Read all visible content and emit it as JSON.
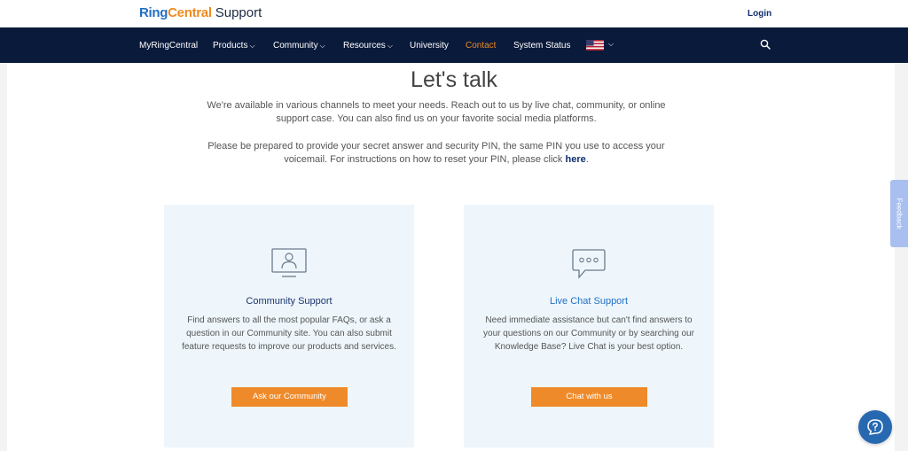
{
  "header": {
    "logo_ring": "Ring",
    "logo_central": "Central",
    "logo_support": "Support",
    "login_label": "Login"
  },
  "nav": {
    "items": [
      {
        "label": "MyRingCentral",
        "dropdown": false
      },
      {
        "label": "Products",
        "dropdown": true
      },
      {
        "label": "Community",
        "dropdown": true
      },
      {
        "label": "Resources",
        "dropdown": true
      },
      {
        "label": "University",
        "dropdown": false
      },
      {
        "label": "Contact",
        "dropdown": false,
        "active": true
      },
      {
        "label": "System Status",
        "dropdown": false
      }
    ],
    "flag_icon": "us-flag-icon",
    "search_icon": "search-icon"
  },
  "main": {
    "title": "Let's talk",
    "intro_p1": "We're available in various channels to meet your needs. Reach out to us by live chat, community, or online support case. You can also find us on your favorite social media platforms.",
    "intro_p2_text": "Please be prepared to provide your secret answer and security PIN, the same PIN you use to access your voicemail. For instructions on how to reset your PIN, please click",
    "intro_p2_link": "here",
    "cards": [
      {
        "icon": "monitor-user-icon",
        "title": "Community Support",
        "description": "Find answers to all the most popular FAQs, or ask a question in our Community site. You can also submit feature requests to improve our products and services.",
        "button": "Ask our Community"
      },
      {
        "icon": "chat-bubble-icon",
        "title": "Live Chat Support",
        "description": "Need immediate assistance but can't find answers to your questions on our Community or by searching our Knowledge Base? Live Chat is your best option.",
        "button": "Chat with us"
      }
    ]
  },
  "feedback_label": "Feedback",
  "help_icon": "help-chat-icon",
  "colors": {
    "nav_bg": "#0a1a3b",
    "accent_orange": "#ef8a2a",
    "brand_blue": "#1f6fc5",
    "card_bg": "#eef6fb"
  }
}
